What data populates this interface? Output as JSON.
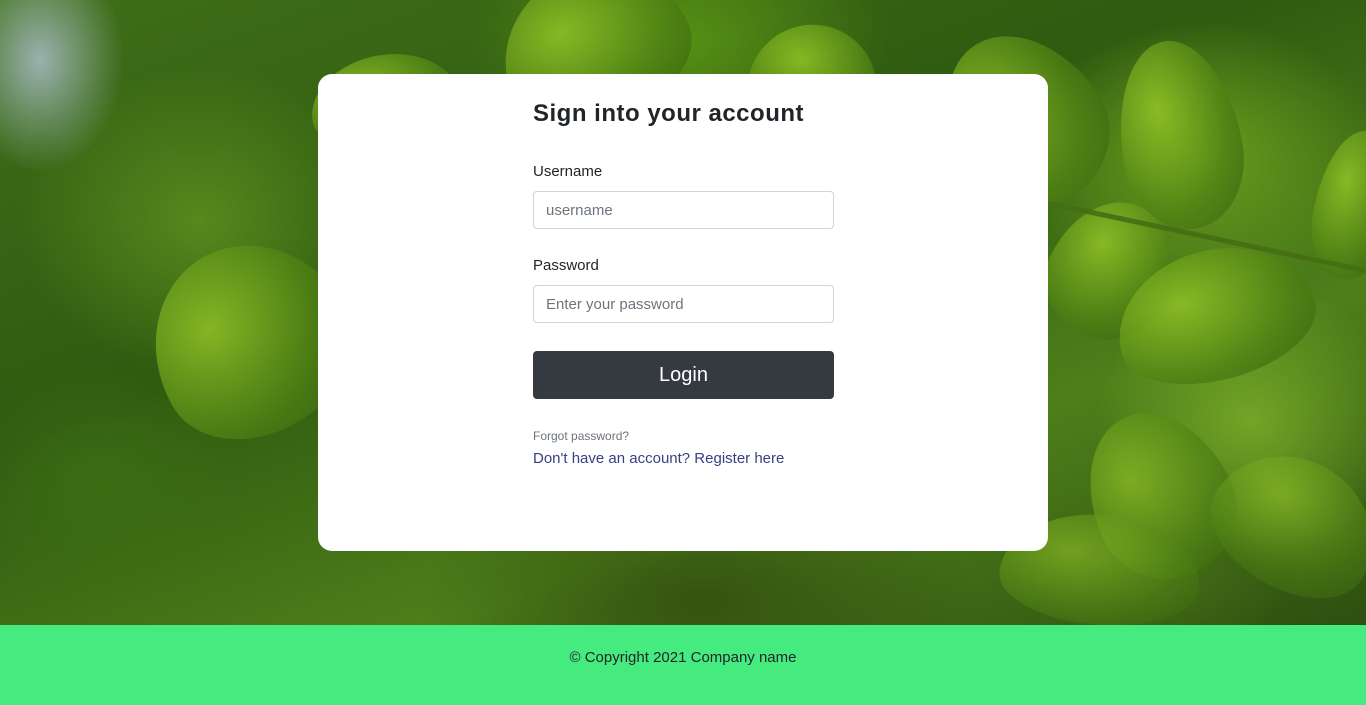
{
  "login": {
    "title": "Sign into your account",
    "username_label": "Username",
    "username_placeholder": "username",
    "username_value": "",
    "password_label": "Password",
    "password_placeholder": "Enter your password",
    "password_value": "",
    "login_button": "Login",
    "forgot_password": "Forgot password?",
    "register_link": "Don't have an account? Register here"
  },
  "footer": {
    "copyright": "© Copyright 2021 Company name"
  },
  "colors": {
    "footer_bg": "#46eb80",
    "button_bg": "#343a40",
    "link": "#393f81"
  }
}
